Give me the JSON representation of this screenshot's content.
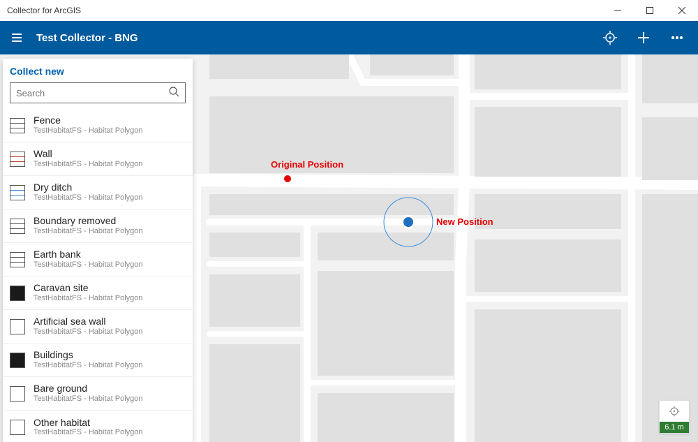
{
  "window": {
    "title": "Collector for ArcGIS"
  },
  "header": {
    "title": "Test Collector - BNG"
  },
  "panel": {
    "title": "Collect new",
    "search_placeholder": "Search",
    "items": [
      {
        "label": "Fence",
        "sub": "TestHabitatFS - Habitat Polygon",
        "swatch": "lines"
      },
      {
        "label": "Wall",
        "sub": "TestHabitatFS - Habitat Polygon",
        "swatch": "lines red"
      },
      {
        "label": "Dry ditch",
        "sub": "TestHabitatFS - Habitat Polygon",
        "swatch": "lines blue"
      },
      {
        "label": "Boundary removed",
        "sub": "TestHabitatFS - Habitat Polygon",
        "swatch": "lines"
      },
      {
        "label": "Earth bank",
        "sub": "TestHabitatFS - Habitat Polygon",
        "swatch": "lines"
      },
      {
        "label": "Caravan site",
        "sub": "TestHabitatFS - Habitat Polygon",
        "swatch": "solid-black"
      },
      {
        "label": "Artificial sea wall",
        "sub": "TestHabitatFS - Habitat Polygon",
        "swatch": ""
      },
      {
        "label": "Buildings",
        "sub": "TestHabitatFS - Habitat Polygon",
        "swatch": "solid-black"
      },
      {
        "label": "Bare ground",
        "sub": "TestHabitatFS - Habitat Polygon",
        "swatch": ""
      },
      {
        "label": "Other habitat",
        "sub": "TestHabitatFS - Habitat Polygon",
        "swatch": ""
      }
    ]
  },
  "annotations": {
    "original": "Original Position",
    "new": "New Position"
  },
  "accuracy": {
    "value": "6.1 m"
  }
}
